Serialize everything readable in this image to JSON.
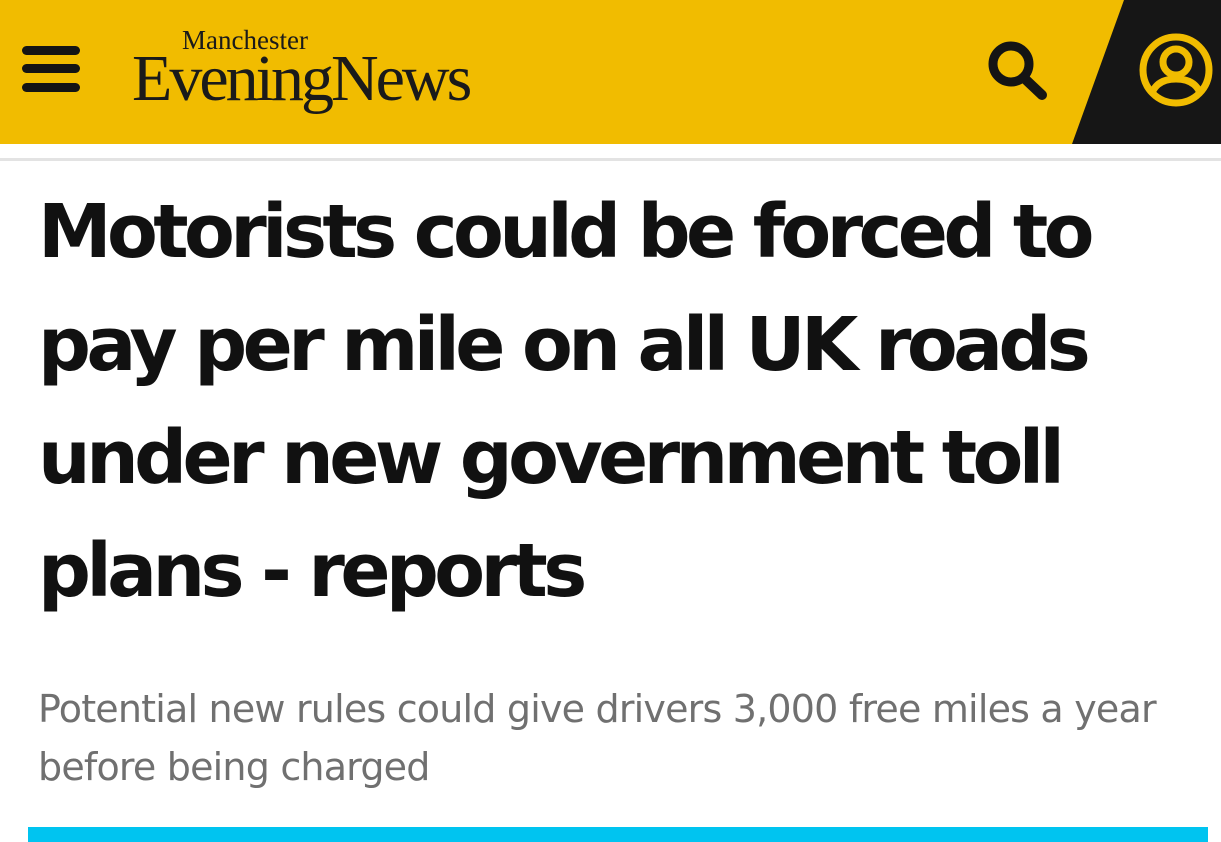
{
  "header": {
    "background_color": "#f1bc00",
    "menu_icon": "hamburger-menu-icon",
    "logo": {
      "top_line": "Manchester",
      "main_line": "EveningNews"
    },
    "search_icon": "search-icon",
    "account_icon": "user-account-icon"
  },
  "article": {
    "headline": "Motorists could be forced to pay per mile on all UK roads under new government toll plans - reports",
    "standfirst": "Potential new rules could give drivers 3,000 free miles a year before being charged"
  },
  "colors": {
    "brand_yellow": "#f1bc00",
    "account_panel": "#161616",
    "media_bar": "#00c4f0",
    "headline_text": "#111111",
    "standfirst_text": "#707070"
  }
}
